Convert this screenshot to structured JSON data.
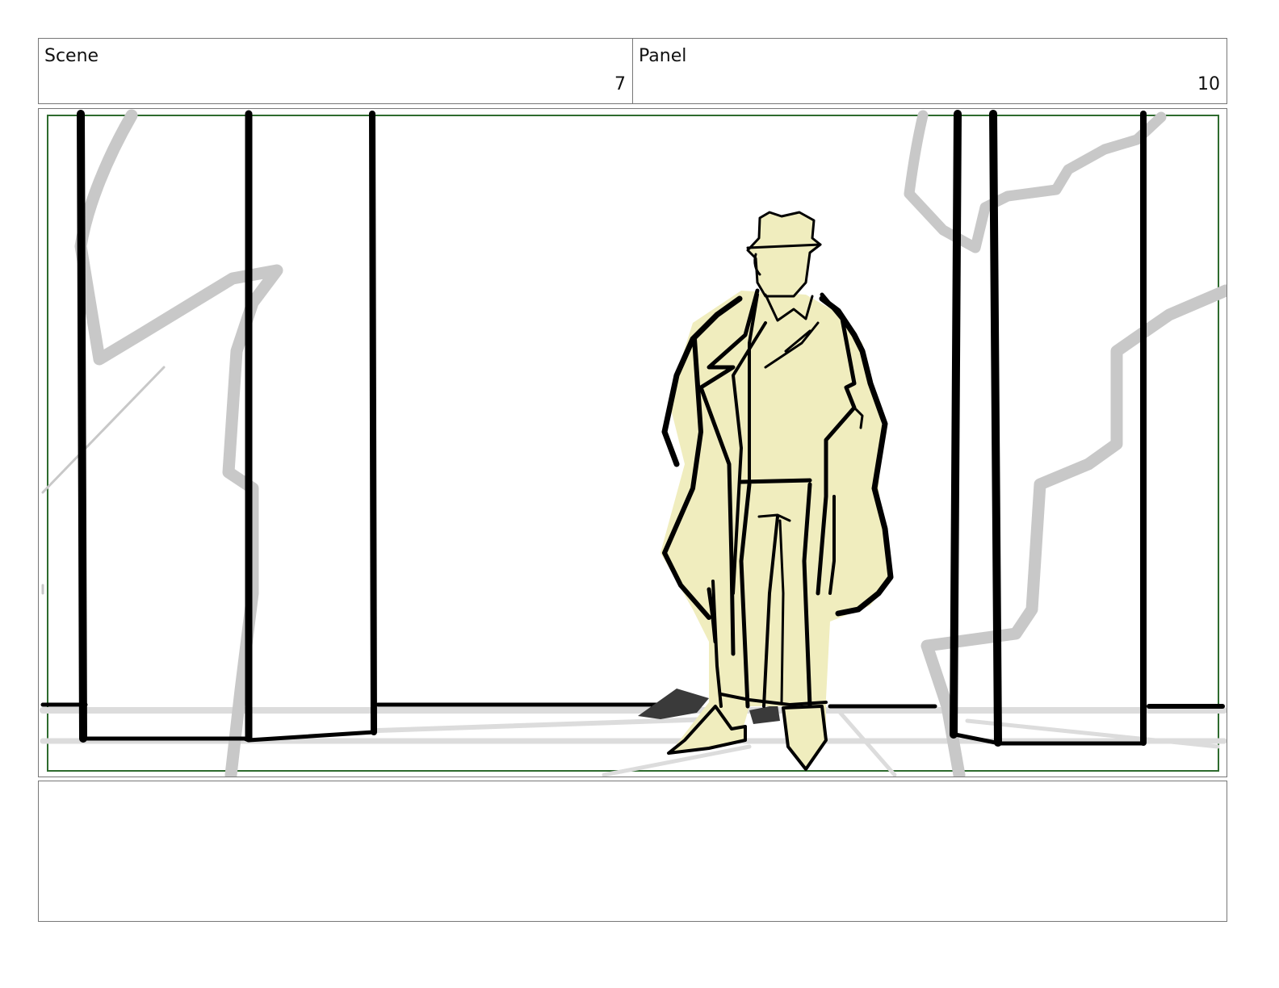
{
  "header": {
    "scene_label": "Scene",
    "scene_number": "7",
    "panel_label": "Panel",
    "panel_number": "10"
  },
  "colors": {
    "border": "#777777",
    "safe_frame": "#2e6b2e",
    "figure_fill": "#f0edbe",
    "ink": "#000000",
    "shadow_gray": "#c8c8c8"
  },
  "notes": {
    "text": ""
  }
}
